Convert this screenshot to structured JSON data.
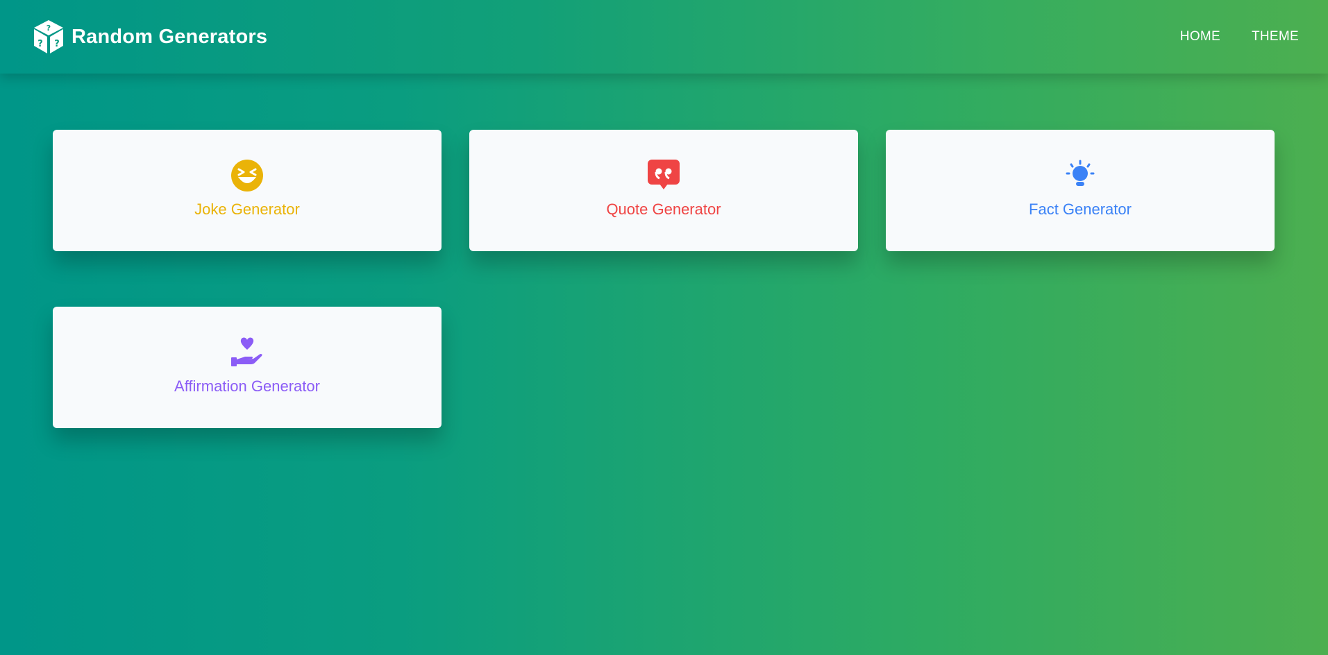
{
  "app": {
    "title": "Random Generators",
    "logo_icon": "dice-icon"
  },
  "nav": {
    "items": [
      {
        "label": "HOME"
      },
      {
        "label": "THEME"
      }
    ]
  },
  "cards": [
    {
      "label": "Joke Generator",
      "icon": "laughing-face-icon",
      "color": "#eab308"
    },
    {
      "label": "Quote Generator",
      "icon": "quote-bubble-icon",
      "color": "#ef4444"
    },
    {
      "label": "Fact Generator",
      "icon": "lightbulb-icon",
      "color": "#3b82f6"
    },
    {
      "label": "Affirmation Generator",
      "icon": "hand-heart-icon",
      "color": "#8b5cf6"
    }
  ],
  "theme": {
    "gradient_start": "#009688",
    "gradient_end": "#4caf50",
    "card_background": "#f8fafc"
  }
}
